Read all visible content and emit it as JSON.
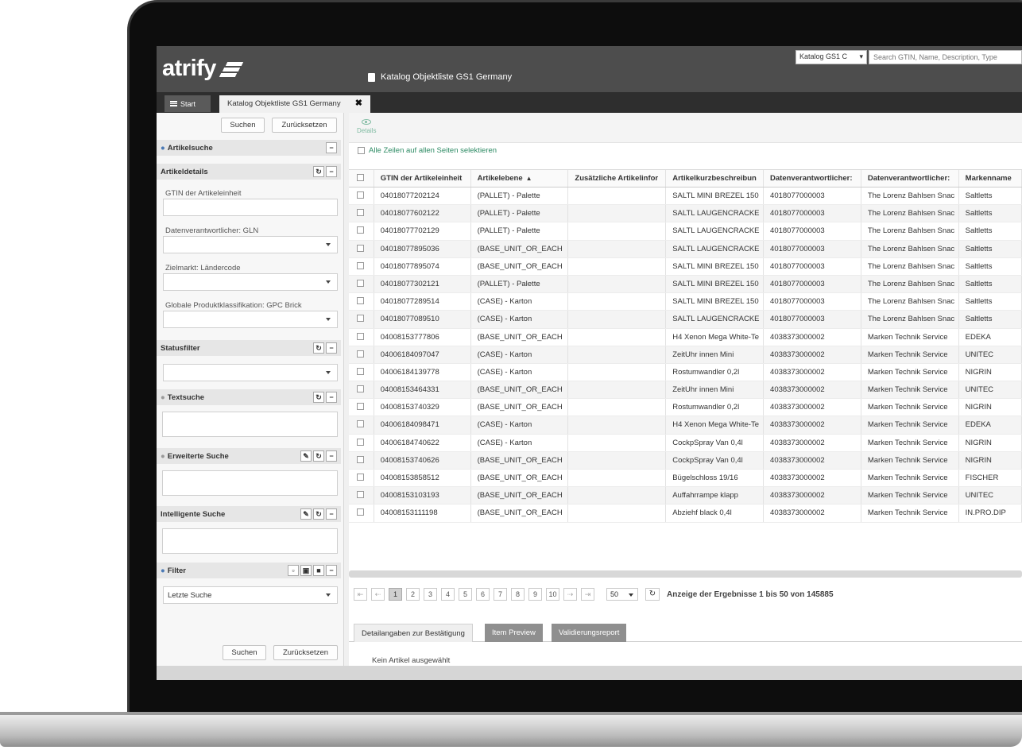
{
  "header": {
    "logo": "atrify",
    "title": "Katalog Objektliste GS1 Germany",
    "catalog_select": "Katalog GS1 C",
    "search_placeholder": "Search GTIN, Name, Description, Type"
  },
  "tabs": {
    "start": "Start",
    "active": "Katalog Objektliste GS1 Germany",
    "close": "✖"
  },
  "left": {
    "search_btn": "Suchen",
    "reset_btn": "Zurücksetzen",
    "artikelsuche": "Artikelsuche",
    "artikeldetails": "Artikeldetails",
    "gtin_label": "GTIN der Artikeleinheit",
    "gln_label": "Datenverantwortlicher: GLN",
    "land_label": "Zielmarkt: Ländercode",
    "gpc_label": "Globale Produktklassifikation: GPC Brick",
    "statusfilter": "Statusfilter",
    "textsuche": "Textsuche",
    "erweiterte": "Erweiterte Suche",
    "intelligente": "Intelligente Suche",
    "filter": "Filter",
    "filter_value": "Letzte Suche"
  },
  "main": {
    "details_label": "Details",
    "select_all": "Alle Zeilen auf allen Seiten selektieren",
    "columns": [
      "GTIN der Artikeleinheit",
      "Artikelebene",
      "Zusätzliche Artikelinfor",
      "Artikelkurzbeschreibun",
      "Datenverantwortlicher:",
      "Datenverantwortlicher:",
      "Markenname"
    ],
    "rows": [
      [
        "04018077202124",
        "(PALLET) - Palette",
        "",
        "SALTL MINI BREZEL 150",
        "4018077000003",
        "The Lorenz Bahlsen Snac",
        "Saltletts"
      ],
      [
        "04018077602122",
        "(PALLET) - Palette",
        "",
        "SALTL LAUGENCRACKE",
        "4018077000003",
        "The Lorenz Bahlsen Snac",
        "Saltletts"
      ],
      [
        "04018077702129",
        "(PALLET) - Palette",
        "",
        "SALTL LAUGENCRACKE",
        "4018077000003",
        "The Lorenz Bahlsen Snac",
        "Saltletts"
      ],
      [
        "04018077895036",
        "(BASE_UNIT_OR_EACH",
        "",
        "SALTL LAUGENCRACKE",
        "4018077000003",
        "The Lorenz Bahlsen Snac",
        "Saltletts"
      ],
      [
        "04018077895074",
        "(BASE_UNIT_OR_EACH",
        "",
        "SALTL MINI BREZEL 150",
        "4018077000003",
        "The Lorenz Bahlsen Snac",
        "Saltletts"
      ],
      [
        "04018077302121",
        "(PALLET) - Palette",
        "",
        "SALTL MINI BREZEL 150",
        "4018077000003",
        "The Lorenz Bahlsen Snac",
        "Saltletts"
      ],
      [
        "04018077289514",
        "(CASE) - Karton",
        "",
        "SALTL MINI BREZEL 150",
        "4018077000003",
        "The Lorenz Bahlsen Snac",
        "Saltletts"
      ],
      [
        "04018077089510",
        "(CASE) - Karton",
        "",
        "SALTL LAUGENCRACKE",
        "4018077000003",
        "The Lorenz Bahlsen Snac",
        "Saltletts"
      ],
      [
        "04008153777806",
        "(BASE_UNIT_OR_EACH",
        "",
        "H4 Xenon Mega White-Te",
        "4038373000002",
        "Marken Technik Service",
        "EDEKA"
      ],
      [
        "04006184097047",
        "(CASE) - Karton",
        "",
        "ZeitUhr innen Mini",
        "4038373000002",
        "Marken Technik Service",
        "UNITEC"
      ],
      [
        "04006184139778",
        "(CASE) - Karton",
        "",
        "Rostumwandler 0,2l",
        "4038373000002",
        "Marken Technik Service",
        "NIGRIN"
      ],
      [
        "04008153464331",
        "(BASE_UNIT_OR_EACH",
        "",
        "ZeitUhr innen Mini",
        "4038373000002",
        "Marken Technik Service",
        "UNITEC"
      ],
      [
        "04008153740329",
        "(BASE_UNIT_OR_EACH",
        "",
        "Rostumwandler 0,2l",
        "4038373000002",
        "Marken Technik Service",
        "NIGRIN"
      ],
      [
        "04006184098471",
        "(CASE) - Karton",
        "",
        "H4 Xenon Mega White-Te",
        "4038373000002",
        "Marken Technik Service",
        "EDEKA"
      ],
      [
        "04006184740622",
        "(CASE) - Karton",
        "",
        "CockpSpray Van 0,4l",
        "4038373000002",
        "Marken Technik Service",
        "NIGRIN"
      ],
      [
        "04008153740626",
        "(BASE_UNIT_OR_EACH",
        "",
        "CockpSpray Van 0,4l",
        "4038373000002",
        "Marken Technik Service",
        "NIGRIN"
      ],
      [
        "04008153858512",
        "(BASE_UNIT_OR_EACH",
        "",
        "Bügelschloss 19/16",
        "4038373000002",
        "Marken Technik Service",
        "FISCHER"
      ],
      [
        "04008153103193",
        "(BASE_UNIT_OR_EACH",
        "",
        "Auffahrrampe klapp",
        "4038373000002",
        "Marken Technik Service",
        "UNITEC"
      ],
      [
        "04008153111198",
        "(BASE_UNIT_OR_EACH",
        "",
        "Abziehf black 0,4l",
        "4038373000002",
        "Marken Technik Service",
        "IN.PRO.DIP"
      ]
    ],
    "pager": {
      "first": "⇤",
      "prev": "⇠",
      "pages": [
        "1",
        "2",
        "3",
        "4",
        "5",
        "6",
        "7",
        "8",
        "9",
        "10"
      ],
      "next": "⇢",
      "last": "⇥",
      "page_size": "50",
      "info": "Anzeige der Ergebnisse 1 bis 50 von 145885"
    },
    "bottom_tabs": [
      "Detailangaben zur Bestätigung",
      "Item Preview",
      "Validierungsreport"
    ],
    "empty_message": "Kein Artikel ausgewählt"
  },
  "colors": {
    "header_bg": "#4d4d4d",
    "tab_bar_bg": "#2e2e2e",
    "accent_green": "#2c8a63",
    "accent_blue": "#4a79b5"
  }
}
